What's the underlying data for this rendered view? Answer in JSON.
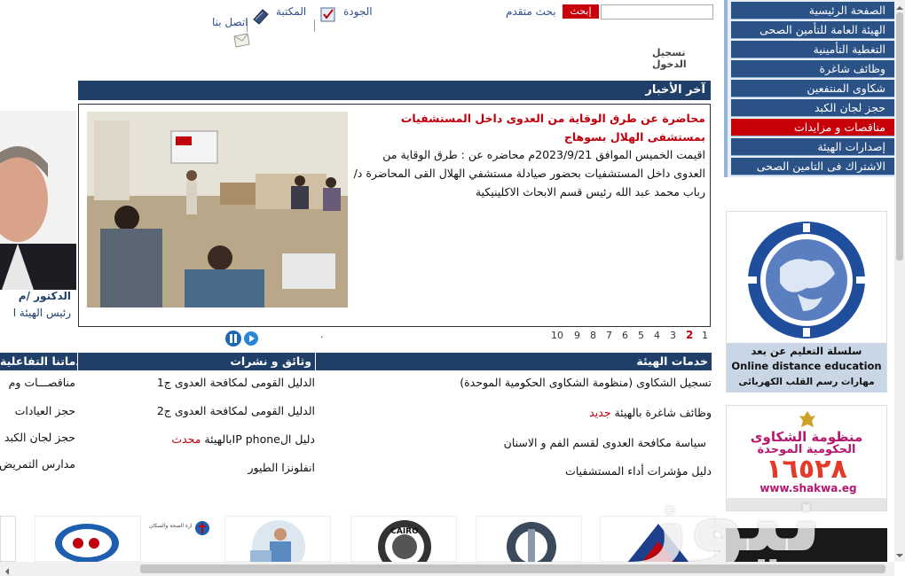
{
  "header": {
    "search_button": "إبحث",
    "search_value": "",
    "advanced_search": "بحث متقدم",
    "quality": "الجودة",
    "library": "المكتبة",
    "contact_us": "اتصل بنا",
    "login": "تسجيل الدخول"
  },
  "sidebar": {
    "items": [
      {
        "label": "الصفحة الرئيسية"
      },
      {
        "label": "الهيئة العامة للتأمين الصحى"
      },
      {
        "label": "التغطية التأمينية"
      },
      {
        "label": "وظائف شاغرة"
      },
      {
        "label": "شكاوى المنتفعين"
      },
      {
        "label": "حجز لجان الكبد"
      },
      {
        "label": "مناقصات و مزايدات"
      },
      {
        "label": "إصدارات الهيئة"
      },
      {
        "label": "الاشتراك فى التامين الصحى"
      }
    ]
  },
  "banners": {
    "distance_ed_line1": "سلسلة التعليم عن بعد",
    "distance_ed_line2": "Online distance education",
    "distance_ed_line3": "مهارات رسم القلب الكهربائى",
    "complaints_line1": "منظومة الشكاوى",
    "complaints_line2": "الحكومية الموحدة",
    "complaints_number": "١٦٥٢٨",
    "complaints_url": "www.shakwa.eg"
  },
  "news": {
    "section_title": "آخر الأخبار",
    "title": "محاضرة عن طرق الوقاية من العدوى داخل المستشفيات بمستشفى الهلال بسوهاج",
    "body": "اقيمت الخميس الموافق 2023/9/21م محاضره عن : طرق الوقاية من العدوى داخل المستشفيات بحضور صيادلة مستشفي الهلال القى المحاضرة د/ رباب محمد عبد الله رئيس قسم الابحاث الاكلينيكية",
    "pages": [
      "1",
      "2",
      "3",
      "4",
      "5",
      "6",
      "7",
      "8",
      "9",
      "10"
    ],
    "current_page": "2",
    "dot": "."
  },
  "profile": {
    "name": "الدكتور /م",
    "role": "رئيس الهيئة ا"
  },
  "services": {
    "title": "خدمات الهيئة",
    "items": [
      {
        "label": "تسجيل الشكاوى (منظومة الشكاوى الحكومية الموحدة)",
        "tag": ""
      },
      {
        "label": "وظائف شاغرة بالهيئة",
        "tag": "جديد"
      },
      {
        "label": "سياسة مكافحة العدوى لقسم الفم و الاسنان",
        "tag": ""
      },
      {
        "label": "دليل مؤشرات أداء المستشفيات",
        "tag": ""
      }
    ]
  },
  "docs": {
    "title": "وثائق و نشرات",
    "items": [
      {
        "label": "الدليل القومى لمكافحة العدوى ج1",
        "tag": ""
      },
      {
        "label": "الدليل القومى لمكافحة العدوى ج2",
        "tag": ""
      },
      {
        "label": "دليل الIP phoneبالهيئة",
        "tag": "محدث"
      },
      {
        "label": "انفلونزا الطيور",
        "tag": ""
      }
    ]
  },
  "interactive": {
    "title": "خدماتنا التفاعلية",
    "items": [
      {
        "label": "مناقصـــات وم"
      },
      {
        "label": "حجز العيادات"
      },
      {
        "label": "حجز لجان الكبد"
      },
      {
        "label": "مدارس التمريض"
      }
    ]
  },
  "watermark": "نيوز",
  "logos": {
    "cairo_text": "CAIRO",
    "ministry_text": "وزارة الصحة والسكان"
  },
  "colors": {
    "nav_blue": "#2b5287",
    "header_blue": "#1f3f69",
    "accent_red": "#c0000c"
  }
}
